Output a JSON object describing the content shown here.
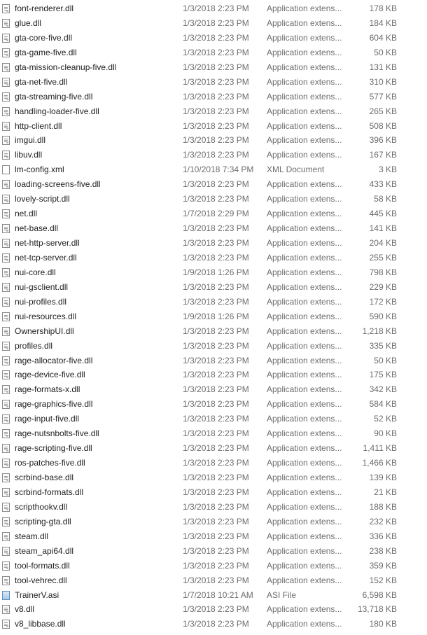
{
  "files": [
    {
      "name": "font-renderer.dll",
      "date": "1/3/2018 2:23 PM",
      "type": "Application extens...",
      "size": "178 KB",
      "icon": "dll-file-icon"
    },
    {
      "name": "glue.dll",
      "date": "1/3/2018 2:23 PM",
      "type": "Application extens...",
      "size": "184 KB",
      "icon": "dll-file-icon"
    },
    {
      "name": "gta-core-five.dll",
      "date": "1/3/2018 2:23 PM",
      "type": "Application extens...",
      "size": "604 KB",
      "icon": "dll-file-icon"
    },
    {
      "name": "gta-game-five.dll",
      "date": "1/3/2018 2:23 PM",
      "type": "Application extens...",
      "size": "50 KB",
      "icon": "dll-file-icon"
    },
    {
      "name": "gta-mission-cleanup-five.dll",
      "date": "1/3/2018 2:23 PM",
      "type": "Application extens...",
      "size": "131 KB",
      "icon": "dll-file-icon"
    },
    {
      "name": "gta-net-five.dll",
      "date": "1/3/2018 2:23 PM",
      "type": "Application extens...",
      "size": "310 KB",
      "icon": "dll-file-icon"
    },
    {
      "name": "gta-streaming-five.dll",
      "date": "1/3/2018 2:23 PM",
      "type": "Application extens...",
      "size": "577 KB",
      "icon": "dll-file-icon"
    },
    {
      "name": "handling-loader-five.dll",
      "date": "1/3/2018 2:23 PM",
      "type": "Application extens...",
      "size": "265 KB",
      "icon": "dll-file-icon"
    },
    {
      "name": "http-client.dll",
      "date": "1/3/2018 2:23 PM",
      "type": "Application extens...",
      "size": "508 KB",
      "icon": "dll-file-icon"
    },
    {
      "name": "imgui.dll",
      "date": "1/3/2018 2:23 PM",
      "type": "Application extens...",
      "size": "396 KB",
      "icon": "dll-file-icon"
    },
    {
      "name": "libuv.dll",
      "date": "1/3/2018 2:23 PM",
      "type": "Application extens...",
      "size": "167 KB",
      "icon": "dll-file-icon"
    },
    {
      "name": "lm-config.xml",
      "date": "1/10/2018 7:34 PM",
      "type": "XML Document",
      "size": "3 KB",
      "icon": "xml-file-icon"
    },
    {
      "name": "loading-screens-five.dll",
      "date": "1/3/2018 2:23 PM",
      "type": "Application extens...",
      "size": "433 KB",
      "icon": "dll-file-icon"
    },
    {
      "name": "lovely-script.dll",
      "date": "1/3/2018 2:23 PM",
      "type": "Application extens...",
      "size": "58 KB",
      "icon": "dll-file-icon"
    },
    {
      "name": "net.dll",
      "date": "1/7/2018 2:29 PM",
      "type": "Application extens...",
      "size": "445 KB",
      "icon": "dll-file-icon"
    },
    {
      "name": "net-base.dll",
      "date": "1/3/2018 2:23 PM",
      "type": "Application extens...",
      "size": "141 KB",
      "icon": "dll-file-icon"
    },
    {
      "name": "net-http-server.dll",
      "date": "1/3/2018 2:23 PM",
      "type": "Application extens...",
      "size": "204 KB",
      "icon": "dll-file-icon"
    },
    {
      "name": "net-tcp-server.dll",
      "date": "1/3/2018 2:23 PM",
      "type": "Application extens...",
      "size": "255 KB",
      "icon": "dll-file-icon"
    },
    {
      "name": "nui-core.dll",
      "date": "1/9/2018 1:26 PM",
      "type": "Application extens...",
      "size": "798 KB",
      "icon": "dll-file-icon"
    },
    {
      "name": "nui-gsclient.dll",
      "date": "1/3/2018 2:23 PM",
      "type": "Application extens...",
      "size": "229 KB",
      "icon": "dll-file-icon"
    },
    {
      "name": "nui-profiles.dll",
      "date": "1/3/2018 2:23 PM",
      "type": "Application extens...",
      "size": "172 KB",
      "icon": "dll-file-icon"
    },
    {
      "name": "nui-resources.dll",
      "date": "1/9/2018 1:26 PM",
      "type": "Application extens...",
      "size": "590 KB",
      "icon": "dll-file-icon"
    },
    {
      "name": "OwnershipUI.dll",
      "date": "1/3/2018 2:23 PM",
      "type": "Application extens...",
      "size": "1,218 KB",
      "icon": "dll-file-icon"
    },
    {
      "name": "profiles.dll",
      "date": "1/3/2018 2:23 PM",
      "type": "Application extens...",
      "size": "335 KB",
      "icon": "dll-file-icon"
    },
    {
      "name": "rage-allocator-five.dll",
      "date": "1/3/2018 2:23 PM",
      "type": "Application extens...",
      "size": "50 KB",
      "icon": "dll-file-icon"
    },
    {
      "name": "rage-device-five.dll",
      "date": "1/3/2018 2:23 PM",
      "type": "Application extens...",
      "size": "175 KB",
      "icon": "dll-file-icon"
    },
    {
      "name": "rage-formats-x.dll",
      "date": "1/3/2018 2:23 PM",
      "type": "Application extens...",
      "size": "342 KB",
      "icon": "dll-file-icon"
    },
    {
      "name": "rage-graphics-five.dll",
      "date": "1/3/2018 2:23 PM",
      "type": "Application extens...",
      "size": "584 KB",
      "icon": "dll-file-icon"
    },
    {
      "name": "rage-input-five.dll",
      "date": "1/3/2018 2:23 PM",
      "type": "Application extens...",
      "size": "52 KB",
      "icon": "dll-file-icon"
    },
    {
      "name": "rage-nutsnbolts-five.dll",
      "date": "1/3/2018 2:23 PM",
      "type": "Application extens...",
      "size": "90 KB",
      "icon": "dll-file-icon"
    },
    {
      "name": "rage-scripting-five.dll",
      "date": "1/3/2018 2:23 PM",
      "type": "Application extens...",
      "size": "1,411 KB",
      "icon": "dll-file-icon"
    },
    {
      "name": "ros-patches-five.dll",
      "date": "1/3/2018 2:23 PM",
      "type": "Application extens...",
      "size": "1,466 KB",
      "icon": "dll-file-icon"
    },
    {
      "name": "scrbind-base.dll",
      "date": "1/3/2018 2:23 PM",
      "type": "Application extens...",
      "size": "139 KB",
      "icon": "dll-file-icon"
    },
    {
      "name": "scrbind-formats.dll",
      "date": "1/3/2018 2:23 PM",
      "type": "Application extens...",
      "size": "21 KB",
      "icon": "dll-file-icon"
    },
    {
      "name": "scripthookv.dll",
      "date": "1/3/2018 2:23 PM",
      "type": "Application extens...",
      "size": "188 KB",
      "icon": "dll-file-icon"
    },
    {
      "name": "scripting-gta.dll",
      "date": "1/3/2018 2:23 PM",
      "type": "Application extens...",
      "size": "232 KB",
      "icon": "dll-file-icon"
    },
    {
      "name": "steam.dll",
      "date": "1/3/2018 2:23 PM",
      "type": "Application extens...",
      "size": "336 KB",
      "icon": "dll-file-icon"
    },
    {
      "name": "steam_api64.dll",
      "date": "1/3/2018 2:23 PM",
      "type": "Application extens...",
      "size": "238 KB",
      "icon": "dll-file-icon"
    },
    {
      "name": "tool-formats.dll",
      "date": "1/3/2018 2:23 PM",
      "type": "Application extens...",
      "size": "359 KB",
      "icon": "dll-file-icon"
    },
    {
      "name": "tool-vehrec.dll",
      "date": "1/3/2018 2:23 PM",
      "type": "Application extens...",
      "size": "152 KB",
      "icon": "dll-file-icon"
    },
    {
      "name": "TrainerV.asi",
      "date": "1/7/2018 10:21 AM",
      "type": "ASI File",
      "size": "6,598 KB",
      "icon": "asi-file-icon"
    },
    {
      "name": "v8.dll",
      "date": "1/3/2018 2:23 PM",
      "type": "Application extens...",
      "size": "13,718 KB",
      "icon": "dll-file-icon"
    },
    {
      "name": "v8_libbase.dll",
      "date": "1/3/2018 2:23 PM",
      "type": "Application extens...",
      "size": "180 KB",
      "icon": "dll-file-icon"
    }
  ]
}
